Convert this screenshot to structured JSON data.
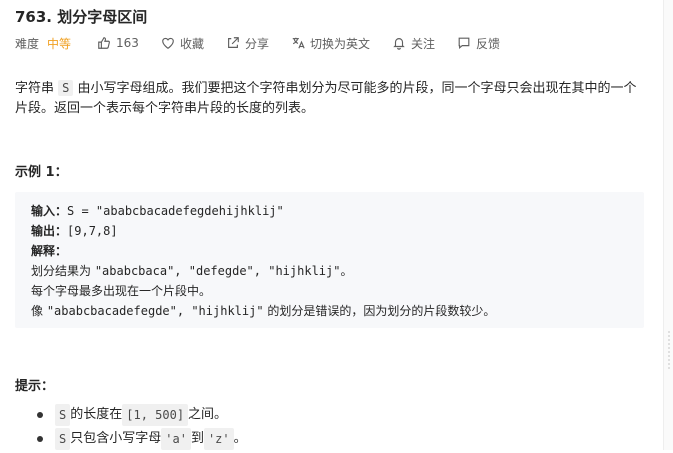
{
  "problem": {
    "title": "763. 划分字母区间",
    "difficulty_label": "难度",
    "difficulty": "中等",
    "likes": "163",
    "favorite": "收藏",
    "share": "分享",
    "switch_lang": "切换为英文",
    "follow": "关注",
    "feedback": "反馈"
  },
  "description": {
    "part1": "字符串 ",
    "var_s": "S",
    "part2": " 由小写字母组成。我们要把这个字符串划分为尽可能多的片段，同一个字母只会出现在其中的一个片段。返回一个表示每个字符串片段的长度的列表。"
  },
  "example": {
    "heading": "示例 1：",
    "input_label": "输入：",
    "input_value": "S = \"ababcbacadefegdehijhklij\"",
    "output_label": "输出：",
    "output_value": "[9,7,8]",
    "explain_label": "解释：",
    "line1_a": "划分结果为 ",
    "line1_b": "\"ababcbaca\", \"defegde\", \"hijhklij\"",
    "line1_c": "。",
    "line2": "每个字母最多出现在一个片段中。",
    "line3_a": "像 ",
    "line3_b": "\"ababcbacadefegde\", \"hijhklij\"",
    "line3_c": " 的划分是错误的，因为划分的片段数较少。"
  },
  "hints": {
    "heading": "提示：",
    "items": [
      {
        "a": "S",
        "b": " 的长度在 ",
        "c": "[1, 500]",
        "d": " 之间。"
      },
      {
        "a": "S",
        "b": " 只包含小写字母 ",
        "c": "'a'",
        "d": " 到 ",
        "e": "'z'",
        "f": " 。"
      }
    ]
  },
  "colors": {
    "difficulty": "#f0a020",
    "example_bg": "#f7f8fa"
  }
}
